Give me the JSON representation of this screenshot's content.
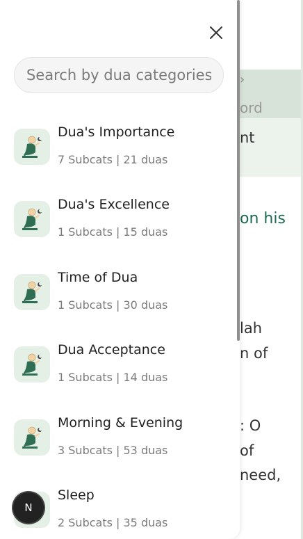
{
  "search": {
    "placeholder": "Search by dua categories"
  },
  "categories": [
    {
      "title": "Dua's Importance",
      "subtitle": "7 Subcats | 21 duas",
      "icon": "praying-person-icon"
    },
    {
      "title": "Dua's Excellence",
      "subtitle": "1 Subcats | 15 duas",
      "icon": "praying-person-icon"
    },
    {
      "title": "Time of Dua",
      "subtitle": "1 Subcats | 30 duas",
      "icon": "praying-person-icon"
    },
    {
      "title": "Dua Acceptance",
      "subtitle": "1 Subcats | 14 duas",
      "icon": "praying-person-icon"
    },
    {
      "title": "Morning & Evening",
      "subtitle": "3 Subcats | 53 duas",
      "icon": "praying-person-icon"
    },
    {
      "title": "Sleep",
      "subtitle": "2 Subcats | 35 duas",
      "icon": "praying-person-icon"
    }
  ],
  "background": {
    "breadcrumb_chevron": "›",
    "fragment_1": "ord",
    "fragment_2": "nt",
    "fragment_3": "on his",
    "fragment_4": "lah",
    "fragment_5": "n of",
    "fragment_6": ": O",
    "fragment_7": "of",
    "fragment_8": "need,"
  },
  "next_badge": {
    "letter": "N"
  },
  "colors": {
    "accent": "#1f6b4f",
    "icon_bg": "#e4efe6",
    "banner": "#d7e3d8"
  }
}
